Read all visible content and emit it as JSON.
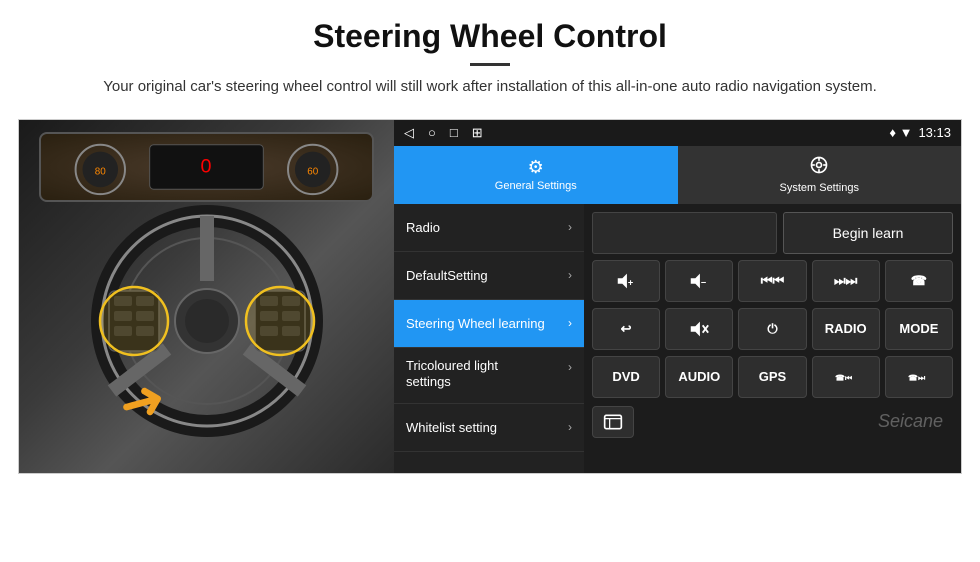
{
  "header": {
    "title": "Steering Wheel Control",
    "description": "Your original car's steering wheel control will still work after installation of this all-in-one auto radio navigation system."
  },
  "status_bar": {
    "back_icon": "◁",
    "home_icon": "○",
    "square_icon": "□",
    "screenshot_icon": "⊞",
    "location_icon": "♦",
    "signal_icon": "▼",
    "time": "13:13"
  },
  "tabs": [
    {
      "label": "General Settings",
      "icon": "⚙",
      "active": true
    },
    {
      "label": "System Settings",
      "icon": "⚙",
      "active": false
    }
  ],
  "menu_items": [
    {
      "label": "Radio",
      "active": false
    },
    {
      "label": "DefaultSetting",
      "active": false
    },
    {
      "label": "Steering Wheel learning",
      "active": true
    },
    {
      "label": "Tricoloured light settings",
      "active": false
    },
    {
      "label": "Whitelist setting",
      "active": false
    }
  ],
  "right_panel": {
    "begin_learn_label": "Begin learn",
    "buttons_row1": [
      "🔊+",
      "🔊−",
      "⏮",
      "⏭",
      "📞"
    ],
    "buttons_row1_symbols": [
      "◀+",
      "◀−",
      "⏮⏮",
      "⏭⏭",
      "☎"
    ],
    "buttons_row2": [
      "↩",
      "🔇x",
      "⏻",
      "RADIO",
      "MODE"
    ],
    "buttons_row3": [
      "DVD",
      "AUDIO",
      "GPS",
      "📞⏮",
      "📞⏭"
    ]
  },
  "watermark": "Seicane"
}
